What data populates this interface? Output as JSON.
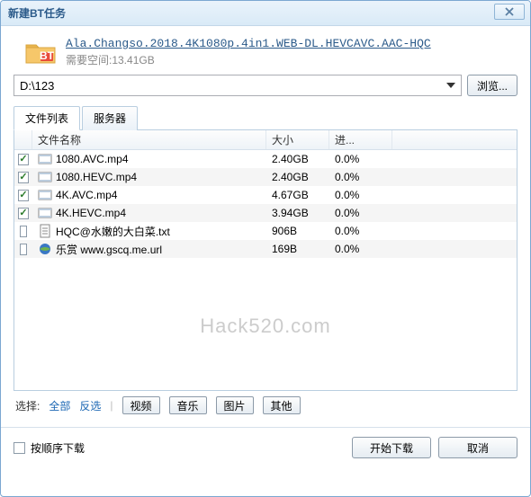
{
  "window": {
    "title": "新建BT任务"
  },
  "file_info": {
    "name": "Ala.Changso.2018.4K1080p.4in1.WEB-DL.HEVCAVC.AAC-HQC",
    "space_label": "需要空间:13.41GB"
  },
  "path": {
    "value": "D:\\123",
    "browse_label": "浏览..."
  },
  "tabs": {
    "files": "文件列表",
    "servers": "服务器"
  },
  "columns": {
    "name": "文件名称",
    "size": "大小",
    "progress": "进..."
  },
  "rows": [
    {
      "checked": true,
      "icon": "video",
      "name": "1080.AVC.mp4",
      "size": "2.40GB",
      "progress": "0.0%"
    },
    {
      "checked": true,
      "icon": "video",
      "name": "1080.HEVC.mp4",
      "size": "2.40GB",
      "progress": "0.0%"
    },
    {
      "checked": true,
      "icon": "video",
      "name": "4K.AVC.mp4",
      "size": "4.67GB",
      "progress": "0.0%"
    },
    {
      "checked": true,
      "icon": "video",
      "name": "4K.HEVC.mp4",
      "size": "3.94GB",
      "progress": "0.0%"
    },
    {
      "checked": false,
      "icon": "text",
      "name": "HQC@水嫩的大白菜.txt",
      "size": "906B",
      "progress": "0.0%"
    },
    {
      "checked": false,
      "icon": "url",
      "name": "乐赏 www.gscq.me.url",
      "size": "169B",
      "progress": "0.0%"
    }
  ],
  "watermark": "Hack520.com",
  "select": {
    "label": "选择:",
    "all": "全部",
    "invert": "反选",
    "video": "视频",
    "music": "音乐",
    "image": "图片",
    "other": "其他"
  },
  "footer": {
    "sequential": "按顺序下载",
    "start": "开始下载",
    "cancel": "取消"
  }
}
